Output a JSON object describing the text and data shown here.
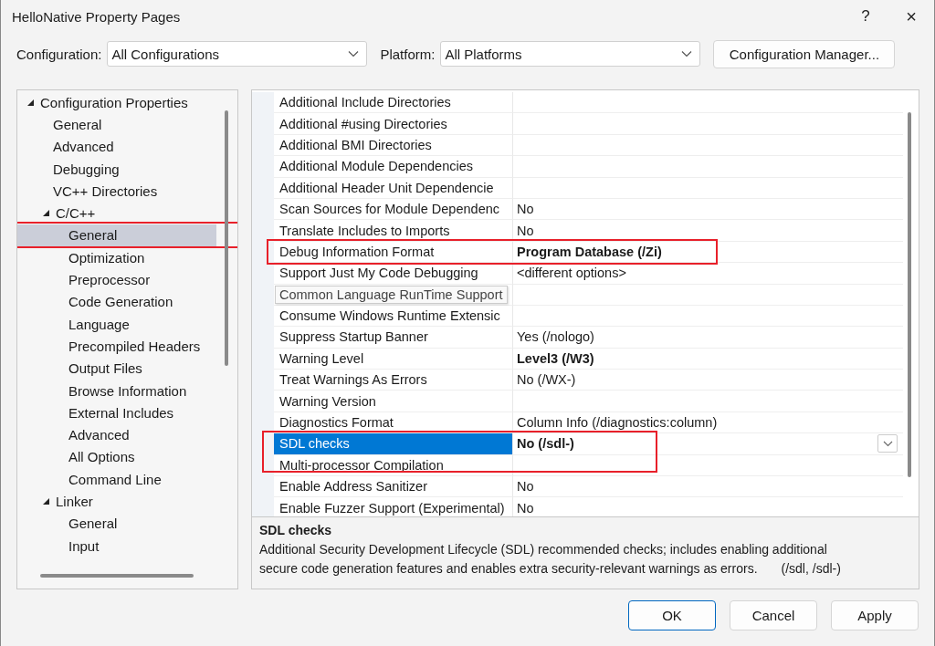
{
  "window": {
    "title": "HelloNative Property Pages",
    "help": "?",
    "close": "×"
  },
  "configuration": {
    "label": "Configuration:",
    "value": "All Configurations"
  },
  "platform": {
    "label": "Platform:",
    "value": "All Platforms"
  },
  "config_manager": "Configuration Manager...",
  "tree": [
    {
      "label": "Configuration Properties",
      "expanded": true,
      "children": [
        {
          "label": "General",
          "selected": false
        },
        {
          "label": "Advanced",
          "selected": false
        },
        {
          "label": "Debugging",
          "selected": false
        },
        {
          "label": "VC++ Directories",
          "selected": false
        },
        {
          "label": "C/C++",
          "expanded": true,
          "children": [
            {
              "label": "General",
              "selected": true,
              "annotated": true
            },
            {
              "label": "Optimization",
              "selected": false
            },
            {
              "label": "Preprocessor",
              "selected": false
            },
            {
              "label": "Code Generation",
              "selected": false
            },
            {
              "label": "Language",
              "selected": false
            },
            {
              "label": "Precompiled Headers",
              "selected": false
            },
            {
              "label": "Output Files",
              "selected": false
            },
            {
              "label": "Browse Information",
              "selected": false
            },
            {
              "label": "External Includes",
              "selected": false
            },
            {
              "label": "Advanced",
              "selected": false
            },
            {
              "label": "All Options",
              "selected": false
            },
            {
              "label": "Command Line",
              "selected": false
            }
          ]
        },
        {
          "label": "Linker",
          "expanded": true,
          "children": [
            {
              "label": "General",
              "selected": false
            },
            {
              "label": "Input",
              "selected": false
            }
          ]
        }
      ]
    }
  ],
  "properties": [
    {
      "name": "Additional Include Directories",
      "selected": false
    },
    {
      "name": "Additional #using Directories",
      "selected": false
    },
    {
      "name": "Additional BMI Directories",
      "selected": false
    },
    {
      "name": "Additional Module Dependencies",
      "selected": false
    },
    {
      "name": "Additional Header Unit Dependencie",
      "selected": false
    },
    {
      "name": "Scan Sources for Module Dependenc",
      "value": "No",
      "selected": false
    },
    {
      "name": "Translate Includes to Imports",
      "value": "No",
      "selected": false
    },
    {
      "name": "Debug Information Format",
      "value": "Program Database (/Zi)",
      "modified": true,
      "selected": false,
      "annotated": true
    },
    {
      "name": "Support Just My Code Debugging",
      "value": "<different options>",
      "selected": false
    },
    {
      "tooltip": "Common Language RunTime Support",
      "selected": false
    },
    {
      "name": "Consume Windows Runtime Extensic",
      "selected": false
    },
    {
      "name": "Suppress Startup Banner",
      "value": "Yes (/nologo)",
      "selected": false
    },
    {
      "name": "Warning Level",
      "value": "Level3 (/W3)",
      "modified": true,
      "selected": false
    },
    {
      "name": "Treat Warnings As Errors",
      "value": "No (/WX-)",
      "selected": false
    },
    {
      "name": "Warning Version",
      "selected": false
    },
    {
      "name": "Diagnostics Format",
      "value": "Column Info (/diagnostics:column)",
      "selected": false
    },
    {
      "name": "SDL checks",
      "value": "No (/sdl-)",
      "modified": true,
      "selected": true,
      "annotated": true
    },
    {
      "name": "Multi-processor Compilation",
      "selected": false
    },
    {
      "name": "Enable Address Sanitizer",
      "value": "No",
      "selected": false
    },
    {
      "name": "Enable Fuzzer Support (Experimental)",
      "value": "No",
      "selected": false
    }
  ],
  "description": {
    "title": "SDL checks",
    "text": "Additional Security Development Lifecycle (SDL) recommended checks; includes enabling additional secure code generation features and enables extra security-relevant warnings as errors.",
    "switch": "(/sdl, /sdl-)"
  },
  "buttons": [
    {
      "label": "OK",
      "default": true
    },
    {
      "label": "Cancel",
      "default": false
    },
    {
      "label": "Apply",
      "default": false
    }
  ]
}
